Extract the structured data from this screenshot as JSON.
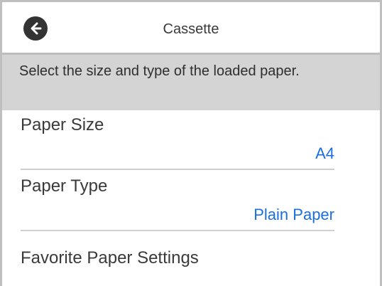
{
  "header": {
    "title": "Cassette",
    "back_icon": "arrow-left-icon"
  },
  "info": {
    "message": "Select the size and type of the loaded paper."
  },
  "settings": [
    {
      "label": "Paper Size",
      "value": "A4"
    },
    {
      "label": "Paper Type",
      "value": "Plain Paper"
    },
    {
      "label": "Favorite Paper Settings"
    }
  ],
  "colors": {
    "accent": "#1a6fe0",
    "info_background": "#d4d4d4",
    "back_button": "#333333"
  }
}
